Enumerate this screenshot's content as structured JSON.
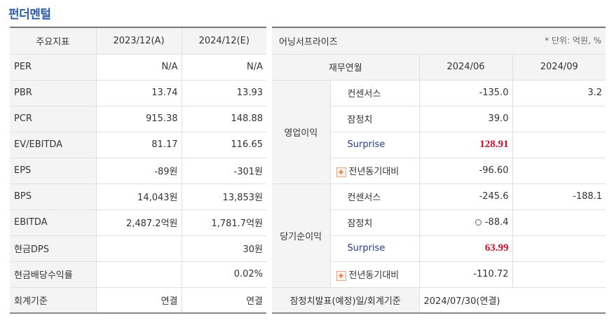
{
  "title": "펀더멘털",
  "fundamental": {
    "headers": [
      "주요지표",
      "2023/12(A)",
      "2024/12(E)"
    ],
    "rows": [
      {
        "label": "PER",
        "a": "N/A",
        "e": "N/A"
      },
      {
        "label": "PBR",
        "a": "13.74",
        "e": "13.93"
      },
      {
        "label": "PCR",
        "a": "915.38",
        "e": "148.88"
      },
      {
        "label": "EV/EBITDA",
        "a": "81.17",
        "e": "116.65"
      },
      {
        "label": "EPS",
        "a": "-89원",
        "e": "-301원"
      },
      {
        "label": "BPS",
        "a": "14,043원",
        "e": "13,853원"
      },
      {
        "label": "EBITDA",
        "a": "2,487.2억원",
        "e": "1,781.7억원"
      },
      {
        "label": "현금DPS",
        "a": "",
        "e": "30원"
      },
      {
        "label": "현금배당수익률",
        "a": "",
        "e": "0.02%"
      },
      {
        "label": "회계기준",
        "a": "연결",
        "e": "연결"
      }
    ]
  },
  "earnings": {
    "title": "어닝서프라이즈",
    "unit_note": "* 단위: 억원, %",
    "col_label": "재무연월",
    "periods": [
      "2024/06",
      "2024/09"
    ],
    "groups": [
      {
        "name": "영업이익",
        "rows": [
          {
            "kind": "컨센서스",
            "v1": "-135.0",
            "v2": "3.2"
          },
          {
            "kind": "잠정치",
            "v1": "39.0",
            "v2": ""
          },
          {
            "kind": "Surprise",
            "v1": "128.91",
            "v2": ""
          },
          {
            "kind": "전년동기대비",
            "v1": "-96.60",
            "v2": ""
          }
        ]
      },
      {
        "name": "당기순이익",
        "rows": [
          {
            "kind": "컨센서스",
            "v1": "-245.6",
            "v2": "-188.1"
          },
          {
            "kind": "잠정치",
            "v1": "-88.4",
            "v2": ""
          },
          {
            "kind": "Surprise",
            "v1": "63.99",
            "v2": ""
          },
          {
            "kind": "전년동기대비",
            "v1": "-110.72",
            "v2": ""
          }
        ]
      }
    ],
    "footer_label": "잠정치발표(예정)일/회계기준",
    "footer_value": "2024/07/30(연결)",
    "colors": {
      "surprise_value": "#c8102e",
      "title": "#2a5ca8"
    }
  }
}
